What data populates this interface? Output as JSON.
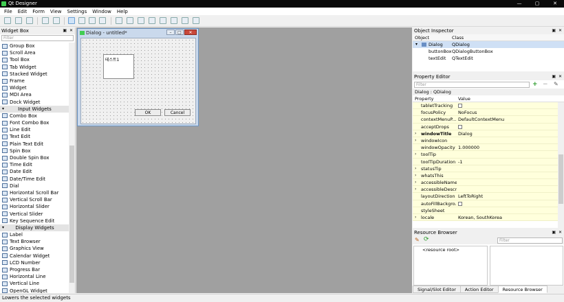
{
  "window": {
    "title": "Qt Designer"
  },
  "menu": [
    "File",
    "Edit",
    "Form",
    "View",
    "Settings",
    "Window",
    "Help"
  ],
  "widget_box": {
    "title": "Widget Box",
    "filter_placeholder": "Filter",
    "items": [
      {
        "type": "item",
        "label": "Group Box"
      },
      {
        "type": "item",
        "label": "Scroll Area"
      },
      {
        "type": "item",
        "label": "Tool Box"
      },
      {
        "type": "item",
        "label": "Tab Widget"
      },
      {
        "type": "item",
        "label": "Stacked Widget"
      },
      {
        "type": "item",
        "label": "Frame"
      },
      {
        "type": "item",
        "label": "Widget"
      },
      {
        "type": "item",
        "label": "MDI Area"
      },
      {
        "type": "item",
        "label": "Dock Widget"
      },
      {
        "type": "category",
        "label": "Input Widgets"
      },
      {
        "type": "item",
        "label": "Combo Box"
      },
      {
        "type": "item",
        "label": "Font Combo Box"
      },
      {
        "type": "item",
        "label": "Line Edit"
      },
      {
        "type": "item",
        "label": "Text Edit"
      },
      {
        "type": "item",
        "label": "Plain Text Edit"
      },
      {
        "type": "item",
        "label": "Spin Box"
      },
      {
        "type": "item",
        "label": "Double Spin Box"
      },
      {
        "type": "item",
        "label": "Time Edit"
      },
      {
        "type": "item",
        "label": "Date Edit"
      },
      {
        "type": "item",
        "label": "Date/Time Edit"
      },
      {
        "type": "item",
        "label": "Dial"
      },
      {
        "type": "item",
        "label": "Horizontal Scroll Bar"
      },
      {
        "type": "item",
        "label": "Vertical Scroll Bar"
      },
      {
        "type": "item",
        "label": "Horizontal Slider"
      },
      {
        "type": "item",
        "label": "Vertical Slider"
      },
      {
        "type": "item",
        "label": "Key Sequence Edit"
      },
      {
        "type": "category",
        "label": "Display Widgets"
      },
      {
        "type": "item",
        "label": "Label"
      },
      {
        "type": "item",
        "label": "Text Browser"
      },
      {
        "type": "item",
        "label": "Graphics View"
      },
      {
        "type": "item",
        "label": "Calendar Widget"
      },
      {
        "type": "item",
        "label": "LCD Number"
      },
      {
        "type": "item",
        "label": "Progress Bar"
      },
      {
        "type": "item",
        "label": "Horizontal Line"
      },
      {
        "type": "item",
        "label": "Vertical Line"
      },
      {
        "type": "item",
        "label": "OpenGL Widget"
      }
    ]
  },
  "dialog": {
    "title": "Dialog - untitled*",
    "textedit_text": "테스트1",
    "ok_label": "OK",
    "cancel_label": "Cancel"
  },
  "object_inspector": {
    "title": "Object Inspector",
    "col_object": "Object",
    "col_class": "Class",
    "rows": [
      {
        "object": "Dialog",
        "class": "QDialog"
      },
      {
        "object": "buttonBox",
        "class": "QDialogButtonBox"
      },
      {
        "object": "textEdit",
        "class": "QTextEdit"
      }
    ]
  },
  "property_editor": {
    "title": "Property Editor",
    "filter_placeholder": "Filter",
    "context": "Dialog : QDialog",
    "col_property": "Property",
    "col_value": "Value",
    "rows": [
      {
        "name": "tabletTracking",
        "value": "",
        "check": true,
        "arrow": false
      },
      {
        "name": "focusPolicy",
        "value": "NoFocus",
        "check": false,
        "arrow": false
      },
      {
        "name": "contextMenuP...",
        "value": "DefaultContextMenu",
        "check": false,
        "arrow": false
      },
      {
        "name": "acceptDrops",
        "value": "",
        "check": true,
        "arrow": false
      },
      {
        "name": "windowTitle",
        "value": "Dialog",
        "check": false,
        "arrow": true,
        "bold": true
      },
      {
        "name": "windowIcon",
        "value": "",
        "check": false,
        "arrow": true
      },
      {
        "name": "windowOpacity",
        "value": "1.000000",
        "check": false,
        "arrow": false
      },
      {
        "name": "toolTip",
        "value": "",
        "check": false,
        "arrow": true
      },
      {
        "name": "toolTipDuration",
        "value": "-1",
        "check": false,
        "arrow": false
      },
      {
        "name": "statusTip",
        "value": "",
        "check": false,
        "arrow": true
      },
      {
        "name": "whatsThis",
        "value": "",
        "check": false,
        "arrow": true
      },
      {
        "name": "accessibleName",
        "value": "",
        "check": false,
        "arrow": true
      },
      {
        "name": "accessibleDescr...",
        "value": "",
        "check": false,
        "arrow": true
      },
      {
        "name": "layoutDirection",
        "value": "LeftToRight",
        "check": false,
        "arrow": false
      },
      {
        "name": "autoFillBackgro...",
        "value": "",
        "check": true,
        "arrow": false
      },
      {
        "name": "styleSheet",
        "value": "",
        "check": false,
        "arrow": false
      },
      {
        "name": "locale",
        "value": "Korean, SouthKorea",
        "check": false,
        "arrow": true
      }
    ]
  },
  "resource_browser": {
    "title": "Resource Browser",
    "filter_placeholder": "Filter",
    "root": "<resource root>"
  },
  "tabs": [
    "Signal/Slot Editor",
    "Action Editor",
    "Resource Browser"
  ],
  "status": "Lowers the selected widgets"
}
